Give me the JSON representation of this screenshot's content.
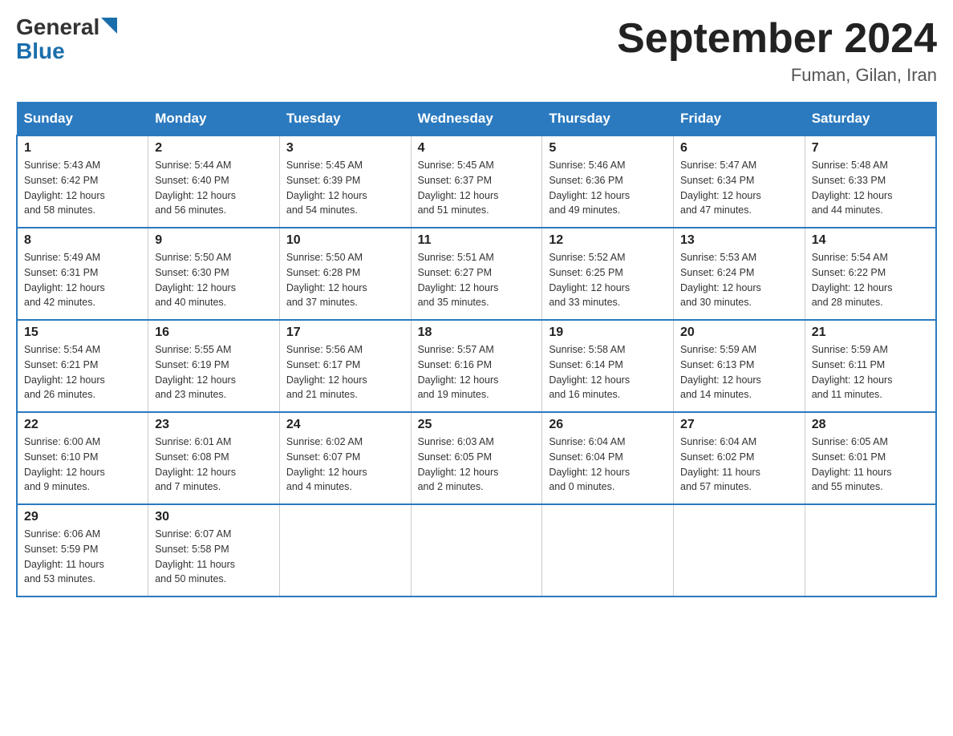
{
  "header": {
    "logo_general": "General",
    "logo_blue": "Blue",
    "month_title": "September 2024",
    "location": "Fuman, Gilan, Iran"
  },
  "weekdays": [
    "Sunday",
    "Monday",
    "Tuesday",
    "Wednesday",
    "Thursday",
    "Friday",
    "Saturday"
  ],
  "weeks": [
    [
      {
        "day": "1",
        "sunrise": "5:43 AM",
        "sunset": "6:42 PM",
        "daylight": "12 hours and 58 minutes."
      },
      {
        "day": "2",
        "sunrise": "5:44 AM",
        "sunset": "6:40 PM",
        "daylight": "12 hours and 56 minutes."
      },
      {
        "day": "3",
        "sunrise": "5:45 AM",
        "sunset": "6:39 PM",
        "daylight": "12 hours and 54 minutes."
      },
      {
        "day": "4",
        "sunrise": "5:45 AM",
        "sunset": "6:37 PM",
        "daylight": "12 hours and 51 minutes."
      },
      {
        "day": "5",
        "sunrise": "5:46 AM",
        "sunset": "6:36 PM",
        "daylight": "12 hours and 49 minutes."
      },
      {
        "day": "6",
        "sunrise": "5:47 AM",
        "sunset": "6:34 PM",
        "daylight": "12 hours and 47 minutes."
      },
      {
        "day": "7",
        "sunrise": "5:48 AM",
        "sunset": "6:33 PM",
        "daylight": "12 hours and 44 minutes."
      }
    ],
    [
      {
        "day": "8",
        "sunrise": "5:49 AM",
        "sunset": "6:31 PM",
        "daylight": "12 hours and 42 minutes."
      },
      {
        "day": "9",
        "sunrise": "5:50 AM",
        "sunset": "6:30 PM",
        "daylight": "12 hours and 40 minutes."
      },
      {
        "day": "10",
        "sunrise": "5:50 AM",
        "sunset": "6:28 PM",
        "daylight": "12 hours and 37 minutes."
      },
      {
        "day": "11",
        "sunrise": "5:51 AM",
        "sunset": "6:27 PM",
        "daylight": "12 hours and 35 minutes."
      },
      {
        "day": "12",
        "sunrise": "5:52 AM",
        "sunset": "6:25 PM",
        "daylight": "12 hours and 33 minutes."
      },
      {
        "day": "13",
        "sunrise": "5:53 AM",
        "sunset": "6:24 PM",
        "daylight": "12 hours and 30 minutes."
      },
      {
        "day": "14",
        "sunrise": "5:54 AM",
        "sunset": "6:22 PM",
        "daylight": "12 hours and 28 minutes."
      }
    ],
    [
      {
        "day": "15",
        "sunrise": "5:54 AM",
        "sunset": "6:21 PM",
        "daylight": "12 hours and 26 minutes."
      },
      {
        "day": "16",
        "sunrise": "5:55 AM",
        "sunset": "6:19 PM",
        "daylight": "12 hours and 23 minutes."
      },
      {
        "day": "17",
        "sunrise": "5:56 AM",
        "sunset": "6:17 PM",
        "daylight": "12 hours and 21 minutes."
      },
      {
        "day": "18",
        "sunrise": "5:57 AM",
        "sunset": "6:16 PM",
        "daylight": "12 hours and 19 minutes."
      },
      {
        "day": "19",
        "sunrise": "5:58 AM",
        "sunset": "6:14 PM",
        "daylight": "12 hours and 16 minutes."
      },
      {
        "day": "20",
        "sunrise": "5:59 AM",
        "sunset": "6:13 PM",
        "daylight": "12 hours and 14 minutes."
      },
      {
        "day": "21",
        "sunrise": "5:59 AM",
        "sunset": "6:11 PM",
        "daylight": "12 hours and 11 minutes."
      }
    ],
    [
      {
        "day": "22",
        "sunrise": "6:00 AM",
        "sunset": "6:10 PM",
        "daylight": "12 hours and 9 minutes."
      },
      {
        "day": "23",
        "sunrise": "6:01 AM",
        "sunset": "6:08 PM",
        "daylight": "12 hours and 7 minutes."
      },
      {
        "day": "24",
        "sunrise": "6:02 AM",
        "sunset": "6:07 PM",
        "daylight": "12 hours and 4 minutes."
      },
      {
        "day": "25",
        "sunrise": "6:03 AM",
        "sunset": "6:05 PM",
        "daylight": "12 hours and 2 minutes."
      },
      {
        "day": "26",
        "sunrise": "6:04 AM",
        "sunset": "6:04 PM",
        "daylight": "12 hours and 0 minutes."
      },
      {
        "day": "27",
        "sunrise": "6:04 AM",
        "sunset": "6:02 PM",
        "daylight": "11 hours and 57 minutes."
      },
      {
        "day": "28",
        "sunrise": "6:05 AM",
        "sunset": "6:01 PM",
        "daylight": "11 hours and 55 minutes."
      }
    ],
    [
      {
        "day": "29",
        "sunrise": "6:06 AM",
        "sunset": "5:59 PM",
        "daylight": "11 hours and 53 minutes."
      },
      {
        "day": "30",
        "sunrise": "6:07 AM",
        "sunset": "5:58 PM",
        "daylight": "11 hours and 50 minutes."
      },
      null,
      null,
      null,
      null,
      null
    ]
  ]
}
